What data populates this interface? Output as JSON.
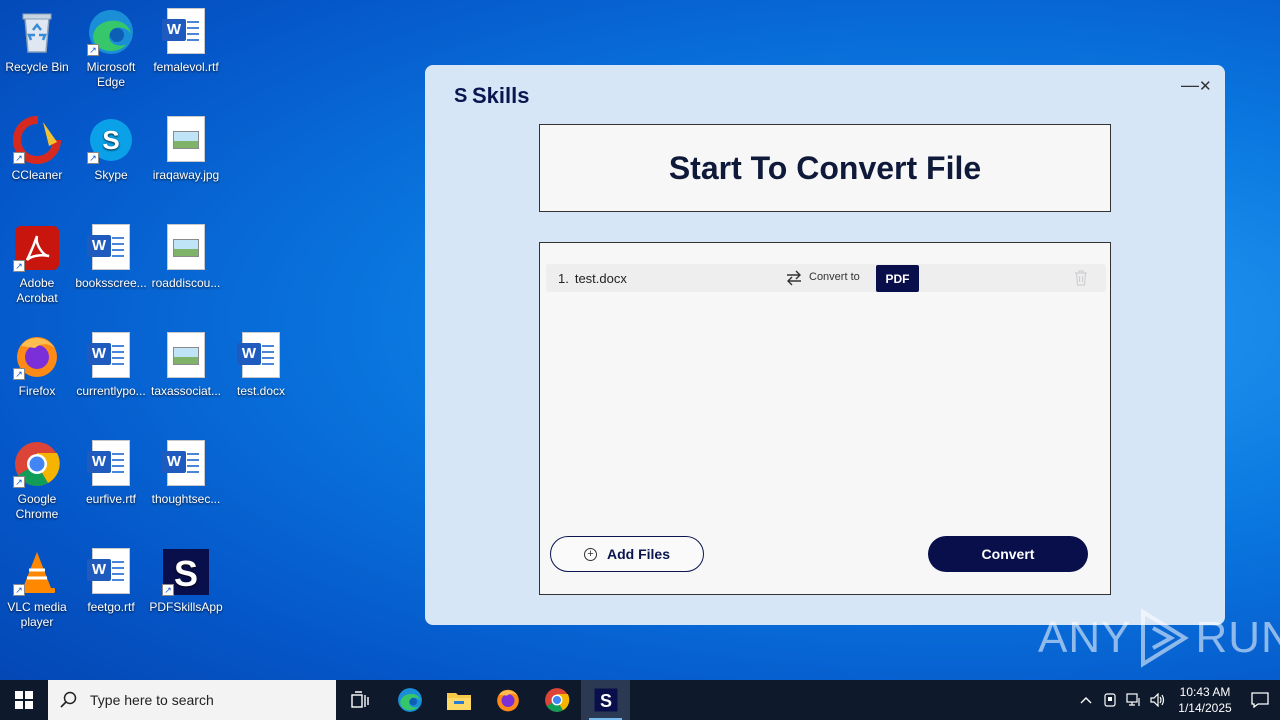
{
  "desktop": {
    "icons": [
      {
        "label": "Recycle Bin",
        "icon": "recycle-bin-icon"
      },
      {
        "label": "Microsoft Edge",
        "icon": "edge-icon"
      },
      {
        "label": "femalevol.rtf",
        "icon": "word-doc-icon"
      },
      {
        "label": "CCleaner",
        "icon": "ccleaner-icon"
      },
      {
        "label": "Skype",
        "icon": "skype-icon"
      },
      {
        "label": "iraqaway.jpg",
        "icon": "image-file-icon"
      },
      {
        "label": "Adobe Acrobat",
        "icon": "acrobat-icon"
      },
      {
        "label": "booksscree...",
        "icon": "word-doc-icon"
      },
      {
        "label": "roaddiscou...",
        "icon": "image-file-icon"
      },
      {
        "label": "Firefox",
        "icon": "firefox-icon"
      },
      {
        "label": "currentlypo...",
        "icon": "word-doc-icon"
      },
      {
        "label": "taxassociat...",
        "icon": "image-file-icon"
      },
      {
        "label": "test.docx",
        "icon": "word-doc-icon"
      },
      {
        "label": "Google Chrome",
        "icon": "chrome-icon"
      },
      {
        "label": "eurfive.rtf",
        "icon": "word-doc-icon"
      },
      {
        "label": "thoughtsec...",
        "icon": "word-doc-icon"
      },
      {
        "label": "VLC media player",
        "icon": "vlc-icon"
      },
      {
        "label": "feetgo.rtf",
        "icon": "word-doc-icon"
      },
      {
        "label": "PDFSkillsApp",
        "icon": "pdfskills-icon"
      }
    ]
  },
  "app": {
    "brand": "Skills",
    "brand_mark": "S",
    "minimize": "—",
    "close": "✕",
    "heading": "Start To Convert File",
    "files": [
      {
        "index": "1.",
        "name": "test.docx",
        "convert_label": "Convert to",
        "format": "PDF"
      }
    ],
    "add_files_label": "Add Files",
    "convert_label": "Convert"
  },
  "watermark": {
    "left": "ANY",
    "right": "RUN"
  },
  "taskbar": {
    "search_placeholder": "Type here to search",
    "apps": [
      "task-view-icon",
      "edge-icon",
      "file-explorer-icon",
      "firefox-icon",
      "chrome-icon",
      "pdfskills-icon"
    ],
    "time": "10:43 AM",
    "date": "1/14/2025"
  },
  "colors": {
    "accent": "#090f4a",
    "window_bg": "#d7e6f6",
    "desktop": "#0a78e0"
  }
}
